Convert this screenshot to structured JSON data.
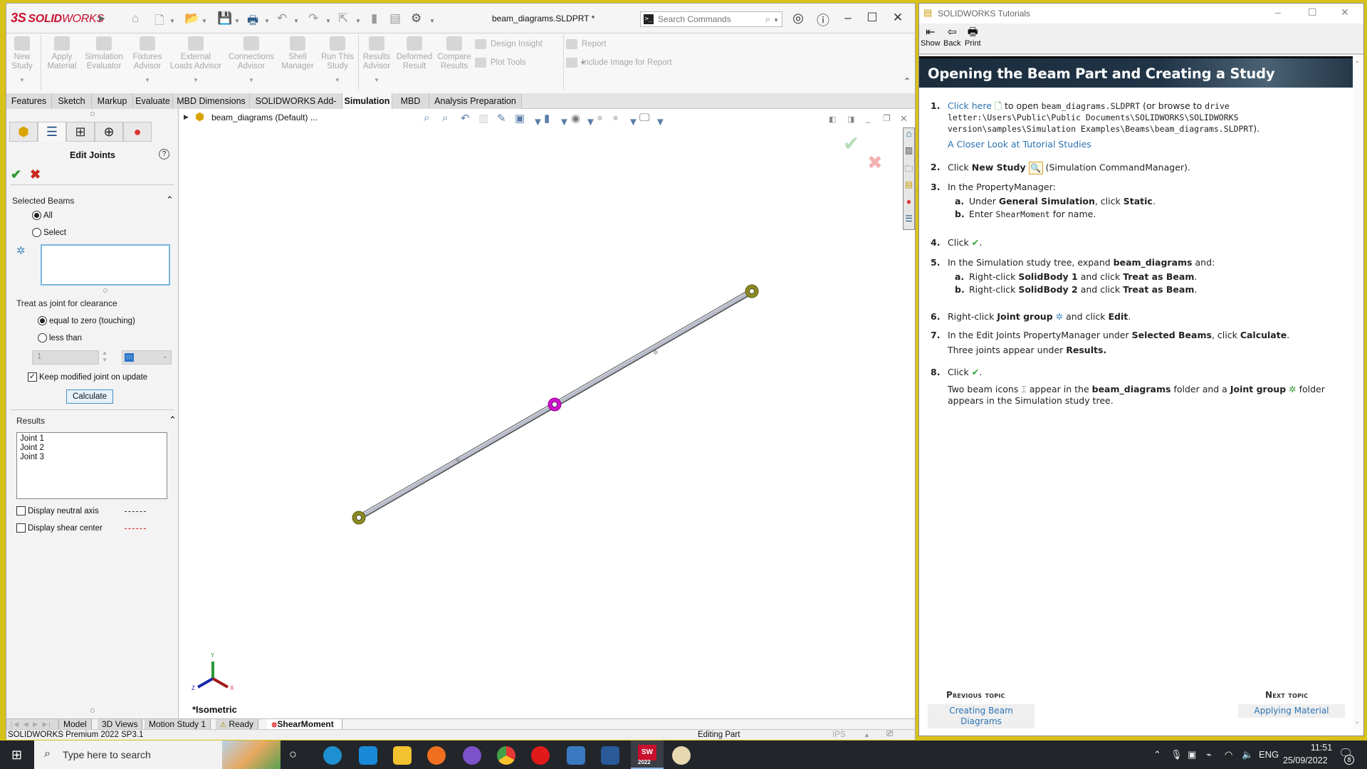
{
  "solidworks": {
    "logo_prefix": "3S",
    "logo_bold": "SOLID",
    "logo_light": "WORKS",
    "document_title": "beam_diagrams.SLDPRT *",
    "search_placeholder": "Search Commands",
    "window_controls": {
      "minimize": "–",
      "maximize": "☐",
      "close": "✕"
    },
    "command_manager": {
      "buttons": [
        {
          "label": "New Study",
          "icon": "new-study-icon"
        },
        {
          "label": "Apply Material",
          "icon": "apply-material-icon"
        },
        {
          "label": "Simulation Evaluator",
          "icon": "simulation-evaluator-icon"
        },
        {
          "label": "Fixtures Advisor",
          "icon": "fixtures-advisor-icon"
        },
        {
          "label": "External Loads Advisor",
          "icon": "external-loads-icon"
        },
        {
          "label": "Connections Advisor",
          "icon": "connections-advisor-icon"
        },
        {
          "label": "Shell Manager",
          "icon": "shell-manager-icon"
        },
        {
          "label": "Run This Study",
          "icon": "run-study-icon"
        },
        {
          "label": "Results Advisor",
          "icon": "results-advisor-icon"
        },
        {
          "label": "Deformed Result",
          "icon": "deformed-result-icon"
        },
        {
          "label": "Compare Results",
          "icon": "compare-results-icon"
        }
      ],
      "design_insight": "Design Insight",
      "plot_tools": "Plot Tools",
      "report": "Report",
      "include_image": "Include Image for Report"
    },
    "tabs": [
      {
        "label": "Features",
        "active": false
      },
      {
        "label": "Sketch",
        "active": false
      },
      {
        "label": "Markup",
        "active": false
      },
      {
        "label": "Evaluate",
        "active": false
      },
      {
        "label": "MBD Dimensions",
        "active": false
      },
      {
        "label": "SOLIDWORKS Add-Ins",
        "active": false
      },
      {
        "label": "Simulation",
        "active": true
      },
      {
        "label": "MBD",
        "active": false
      },
      {
        "label": "Analysis Preparation",
        "active": false
      }
    ],
    "property_manager": {
      "title": "Edit Joints",
      "help": "?",
      "selected_beams": {
        "title": "Selected Beams",
        "option_all": "All",
        "option_select": "Select",
        "selected": "All"
      },
      "clearance": {
        "title": "Treat as joint for clearance",
        "option_zero": "equal to zero (touching)",
        "option_less": "less than",
        "selected": "equal to zero (touching)",
        "value": "1",
        "unit": "m"
      },
      "keep_modified": {
        "label": "Keep modified joint on update",
        "checked": true
      },
      "calculate_label": "Calculate",
      "results": {
        "title": "Results",
        "items": [
          "Joint 1",
          "Joint 2",
          "Joint 3"
        ]
      },
      "display_neutral_axis": {
        "label": "Display neutral axis",
        "checked": false
      },
      "display_shear_center": {
        "label": "Display shear center",
        "checked": false
      }
    },
    "feature_tree_label": "beam_diagrams  (Default) ...",
    "view_label": "*Isometric",
    "triad": {
      "x": "X",
      "y": "Y",
      "z": "Z"
    },
    "bottom_tabs": [
      {
        "label": "Model",
        "active": false
      },
      {
        "label": "3D Views",
        "active": false
      },
      {
        "label": "Motion Study 1",
        "active": false
      },
      {
        "label": "Ready",
        "active": false
      },
      {
        "label": "ShearMoment",
        "active": true
      }
    ],
    "status": {
      "product": "SOLIDWORKS Premium 2022 SP3.1",
      "mode": "Editing Part",
      "units": "IPS"
    }
  },
  "tutorial": {
    "window_title": "SOLIDWORKS Tutorials",
    "toolbar": [
      {
        "label": "Show",
        "icon": "show-icon"
      },
      {
        "label": "Back",
        "icon": "back-arrow-icon"
      },
      {
        "label": "Print",
        "icon": "printer-icon"
      }
    ],
    "heading": "Opening the Beam Part and Creating a Study",
    "steps": {
      "s1_link": "Click here",
      "s1_text": "to open",
      "s1_file": "beam_diagrams.SLDPRT",
      "s1_browse": "(or browse to",
      "s1_path": "drive letter:\\Users\\Public\\Public Documents\\SOLIDWORKS\\SOLIDWORKS version\\samples\\Simulation Examples\\Beams\\beam_diagrams.SLDPRT",
      "s1_end": ").",
      "s1_closer_look": "A Closer Look at Tutorial Studies",
      "s2_pre": "Click",
      "s2_bold": "New Study",
      "s2_post": "(Simulation CommandManager).",
      "s3": "In the PropertyManager:",
      "s3a_pre": "Under",
      "s3a_b1": "General Simulation",
      "s3a_mid": ", click",
      "s3a_b2": "Static",
      "s3b_pre": "Enter",
      "s3b_code": "ShearMoment",
      "s3b_post": "for name.",
      "s4": "Click",
      "s5_pre": "In the Simulation study tree, expand",
      "s5_b": "beam_diagrams",
      "s5_post": "and:",
      "s5a_pre": "Right-click",
      "s5a_b1": "SolidBody 1",
      "s5a_mid": "and click",
      "s5a_b2": "Treat as Beam",
      "s5b_pre": "Right-click",
      "s5b_b1": "SolidBody 2",
      "s5b_mid": "and click",
      "s5b_b2": "Treat as Beam",
      "s6_pre": "Right-click",
      "s6_b1": "Joint group",
      "s6_mid": "and click",
      "s6_b2": "Edit",
      "s7_pre": "In the Edit Joints PropertyManager under",
      "s7_b1": "Selected Beams",
      "s7_mid": ", click",
      "s7_b2": "Calculate",
      "s7_line2_pre": "Three joints appear under",
      "s7_line2_b": "Results.",
      "s8": "Click",
      "s8_p_pre": "Two beam icons",
      "s8_p_mid1": "appear in the",
      "s8_p_b1": "beam_diagrams",
      "s8_p_mid2": "folder and a",
      "s8_p_b2": "Joint group",
      "s8_p_post": "folder appears in the Simulation study tree."
    },
    "previous_topic": {
      "heading": "Previous topic",
      "link": "Creating Beam Diagrams"
    },
    "next_topic": {
      "heading": "Next topic",
      "link": "Applying Material"
    }
  },
  "taskbar": {
    "search_placeholder": "Type here to search",
    "time": "11:51",
    "date": "25/09/2022",
    "language": "ENG",
    "notifications": "8",
    "sw_badge": "2022"
  }
}
